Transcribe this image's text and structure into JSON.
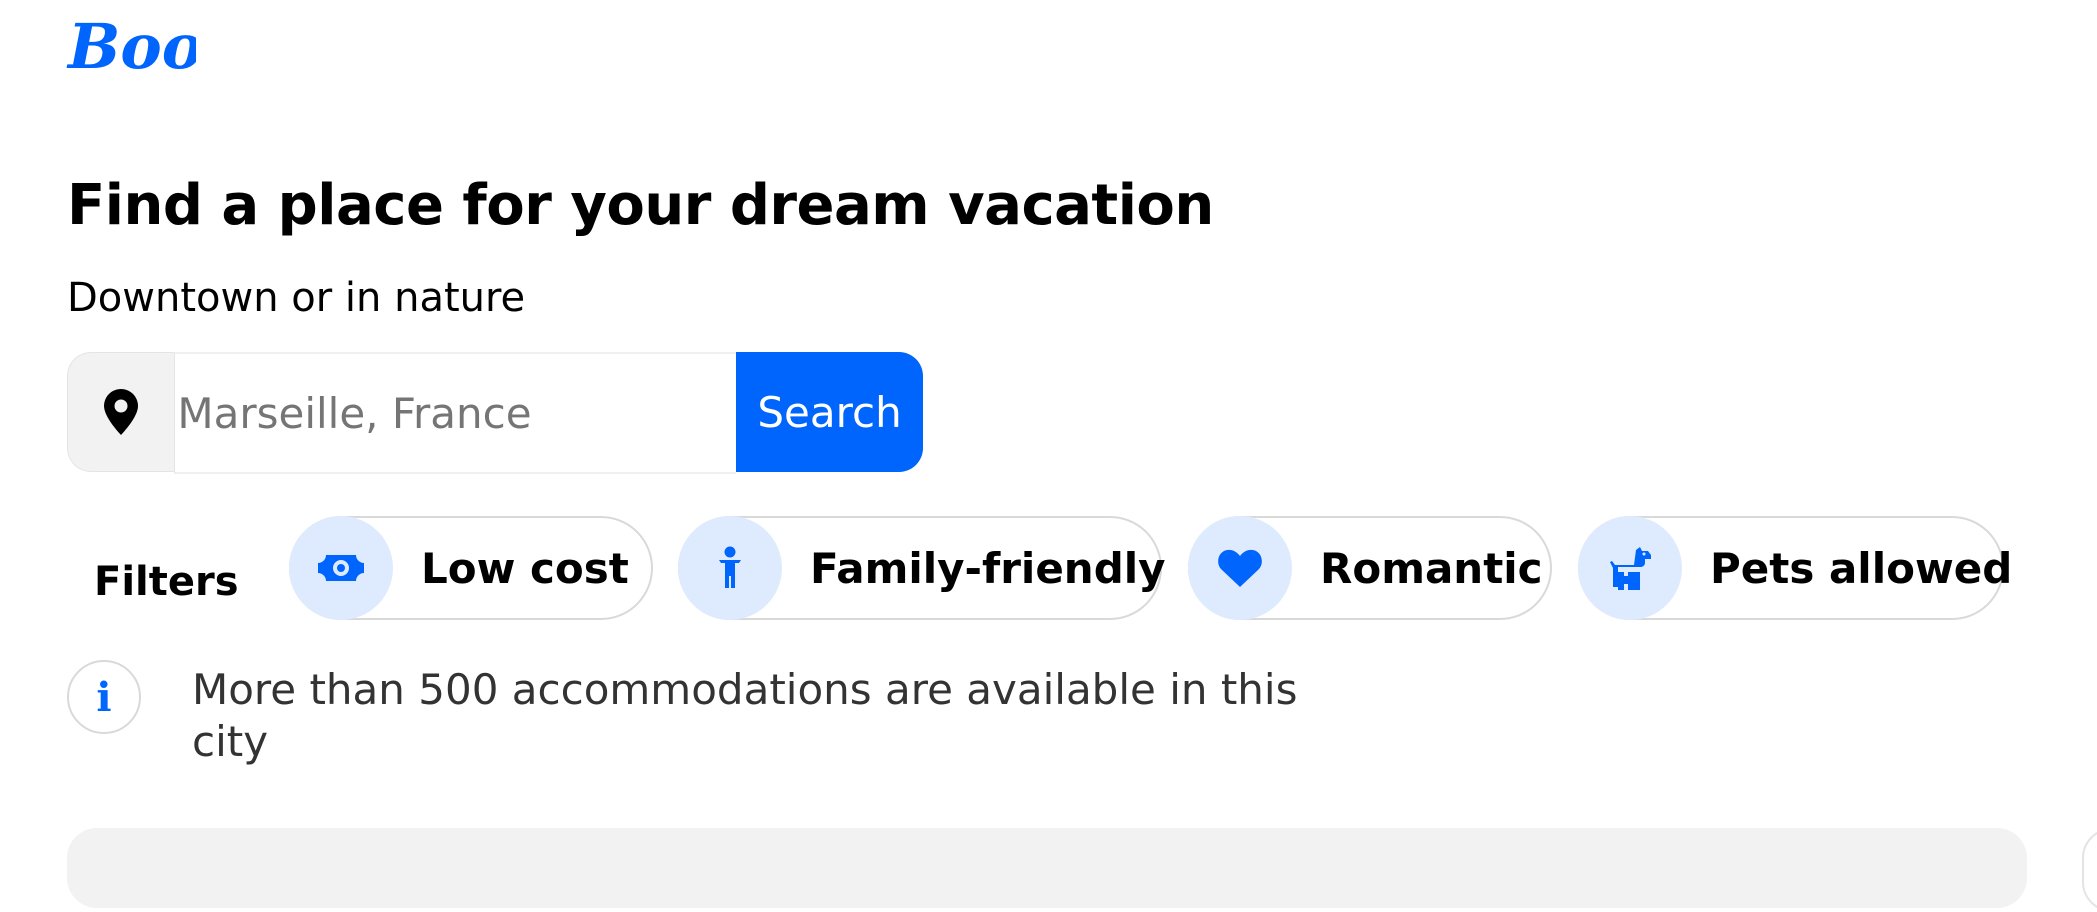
{
  "brand": {
    "logo_text": "Booki",
    "color": "#0065fc"
  },
  "hero": {
    "title": "Find a place for your dream vacation",
    "subtitle": "Downtown or in nature"
  },
  "search": {
    "icon": "location-pin-icon",
    "placeholder": "Marseille, France",
    "button_label": "Search"
  },
  "filters": {
    "label": "Filters",
    "items": [
      {
        "label": "Low cost",
        "icon": "money-bill-icon"
      },
      {
        "label": "Family-friendly",
        "icon": "child-icon"
      },
      {
        "label": "Romantic",
        "icon": "heart-icon"
      },
      {
        "label": "Pets allowed",
        "icon": "dog-icon"
      }
    ]
  },
  "info": {
    "icon": "info-icon",
    "icon_glyph": "i",
    "text": "More than 500 accommodations are available in this city"
  },
  "colors": {
    "accent": "#0065fc",
    "chip_icon_bg": "#deebff",
    "panel_bg": "#f2f2f2"
  }
}
